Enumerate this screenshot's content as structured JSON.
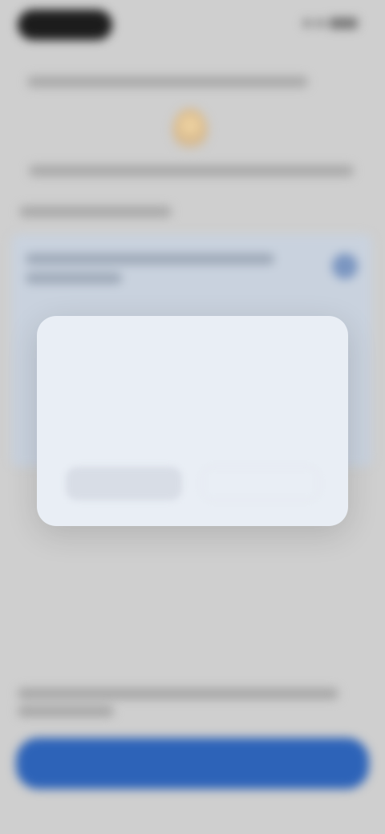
{
  "status_bar": {
    "time": "",
    "icons": [
      "signal-icon",
      "wifi-icon",
      "battery-icon"
    ]
  },
  "page": {
    "headline": "",
    "subheadline": "",
    "section_label": "",
    "card_text": ""
  },
  "dialog": {
    "title": "",
    "body": "",
    "secondary_action": "",
    "primary_action": ""
  },
  "footer": {
    "note": "",
    "cta": ""
  },
  "colors": {
    "background": "#cfcfcf",
    "dialog": "#e9eef5",
    "cta": "#2d63b8",
    "accent": "#7b96c1"
  }
}
